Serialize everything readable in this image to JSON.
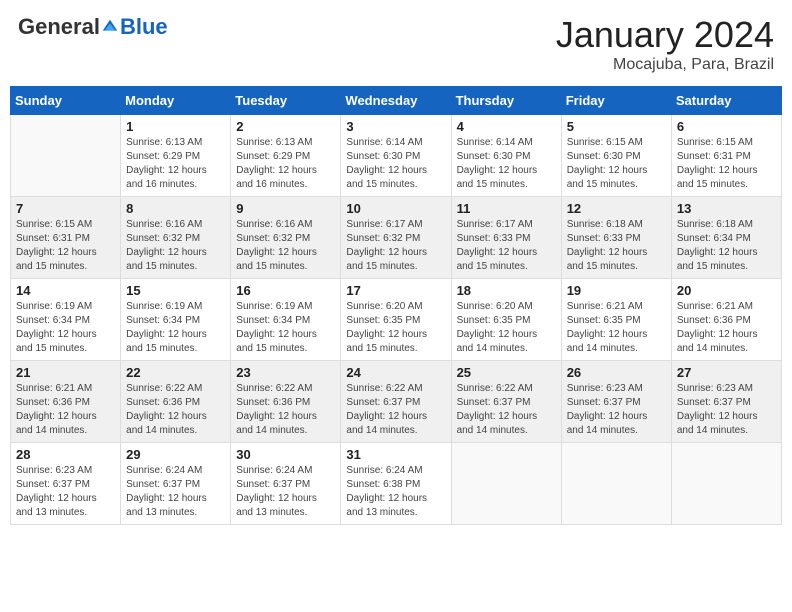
{
  "header": {
    "logo": {
      "general": "General",
      "blue": "Blue"
    },
    "title": "January 2024",
    "subtitle": "Mocajuba, Para, Brazil"
  },
  "weekdays": [
    "Sunday",
    "Monday",
    "Tuesday",
    "Wednesday",
    "Thursday",
    "Friday",
    "Saturday"
  ],
  "weeks": [
    [
      {
        "day": "",
        "sunrise": "",
        "sunset": "",
        "daylight": "",
        "empty": true
      },
      {
        "day": "1",
        "sunrise": "Sunrise: 6:13 AM",
        "sunset": "Sunset: 6:29 PM",
        "daylight": "Daylight: 12 hours and 16 minutes."
      },
      {
        "day": "2",
        "sunrise": "Sunrise: 6:13 AM",
        "sunset": "Sunset: 6:29 PM",
        "daylight": "Daylight: 12 hours and 16 minutes."
      },
      {
        "day": "3",
        "sunrise": "Sunrise: 6:14 AM",
        "sunset": "Sunset: 6:30 PM",
        "daylight": "Daylight: 12 hours and 15 minutes."
      },
      {
        "day": "4",
        "sunrise": "Sunrise: 6:14 AM",
        "sunset": "Sunset: 6:30 PM",
        "daylight": "Daylight: 12 hours and 15 minutes."
      },
      {
        "day": "5",
        "sunrise": "Sunrise: 6:15 AM",
        "sunset": "Sunset: 6:30 PM",
        "daylight": "Daylight: 12 hours and 15 minutes."
      },
      {
        "day": "6",
        "sunrise": "Sunrise: 6:15 AM",
        "sunset": "Sunset: 6:31 PM",
        "daylight": "Daylight: 12 hours and 15 minutes."
      }
    ],
    [
      {
        "day": "7",
        "sunrise": "Sunrise: 6:15 AM",
        "sunset": "Sunset: 6:31 PM",
        "daylight": "Daylight: 12 hours and 15 minutes."
      },
      {
        "day": "8",
        "sunrise": "Sunrise: 6:16 AM",
        "sunset": "Sunset: 6:32 PM",
        "daylight": "Daylight: 12 hours and 15 minutes."
      },
      {
        "day": "9",
        "sunrise": "Sunrise: 6:16 AM",
        "sunset": "Sunset: 6:32 PM",
        "daylight": "Daylight: 12 hours and 15 minutes."
      },
      {
        "day": "10",
        "sunrise": "Sunrise: 6:17 AM",
        "sunset": "Sunset: 6:32 PM",
        "daylight": "Daylight: 12 hours and 15 minutes."
      },
      {
        "day": "11",
        "sunrise": "Sunrise: 6:17 AM",
        "sunset": "Sunset: 6:33 PM",
        "daylight": "Daylight: 12 hours and 15 minutes."
      },
      {
        "day": "12",
        "sunrise": "Sunrise: 6:18 AM",
        "sunset": "Sunset: 6:33 PM",
        "daylight": "Daylight: 12 hours and 15 minutes."
      },
      {
        "day": "13",
        "sunrise": "Sunrise: 6:18 AM",
        "sunset": "Sunset: 6:34 PM",
        "daylight": "Daylight: 12 hours and 15 minutes."
      }
    ],
    [
      {
        "day": "14",
        "sunrise": "Sunrise: 6:19 AM",
        "sunset": "Sunset: 6:34 PM",
        "daylight": "Daylight: 12 hours and 15 minutes."
      },
      {
        "day": "15",
        "sunrise": "Sunrise: 6:19 AM",
        "sunset": "Sunset: 6:34 PM",
        "daylight": "Daylight: 12 hours and 15 minutes."
      },
      {
        "day": "16",
        "sunrise": "Sunrise: 6:19 AM",
        "sunset": "Sunset: 6:34 PM",
        "daylight": "Daylight: 12 hours and 15 minutes."
      },
      {
        "day": "17",
        "sunrise": "Sunrise: 6:20 AM",
        "sunset": "Sunset: 6:35 PM",
        "daylight": "Daylight: 12 hours and 15 minutes."
      },
      {
        "day": "18",
        "sunrise": "Sunrise: 6:20 AM",
        "sunset": "Sunset: 6:35 PM",
        "daylight": "Daylight: 12 hours and 14 minutes."
      },
      {
        "day": "19",
        "sunrise": "Sunrise: 6:21 AM",
        "sunset": "Sunset: 6:35 PM",
        "daylight": "Daylight: 12 hours and 14 minutes."
      },
      {
        "day": "20",
        "sunrise": "Sunrise: 6:21 AM",
        "sunset": "Sunset: 6:36 PM",
        "daylight": "Daylight: 12 hours and 14 minutes."
      }
    ],
    [
      {
        "day": "21",
        "sunrise": "Sunrise: 6:21 AM",
        "sunset": "Sunset: 6:36 PM",
        "daylight": "Daylight: 12 hours and 14 minutes."
      },
      {
        "day": "22",
        "sunrise": "Sunrise: 6:22 AM",
        "sunset": "Sunset: 6:36 PM",
        "daylight": "Daylight: 12 hours and 14 minutes."
      },
      {
        "day": "23",
        "sunrise": "Sunrise: 6:22 AM",
        "sunset": "Sunset: 6:36 PM",
        "daylight": "Daylight: 12 hours and 14 minutes."
      },
      {
        "day": "24",
        "sunrise": "Sunrise: 6:22 AM",
        "sunset": "Sunset: 6:37 PM",
        "daylight": "Daylight: 12 hours and 14 minutes."
      },
      {
        "day": "25",
        "sunrise": "Sunrise: 6:22 AM",
        "sunset": "Sunset: 6:37 PM",
        "daylight": "Daylight: 12 hours and 14 minutes."
      },
      {
        "day": "26",
        "sunrise": "Sunrise: 6:23 AM",
        "sunset": "Sunset: 6:37 PM",
        "daylight": "Daylight: 12 hours and 14 minutes."
      },
      {
        "day": "27",
        "sunrise": "Sunrise: 6:23 AM",
        "sunset": "Sunset: 6:37 PM",
        "daylight": "Daylight: 12 hours and 14 minutes."
      }
    ],
    [
      {
        "day": "28",
        "sunrise": "Sunrise: 6:23 AM",
        "sunset": "Sunset: 6:37 PM",
        "daylight": "Daylight: 12 hours and 13 minutes."
      },
      {
        "day": "29",
        "sunrise": "Sunrise: 6:24 AM",
        "sunset": "Sunset: 6:37 PM",
        "daylight": "Daylight: 12 hours and 13 minutes."
      },
      {
        "day": "30",
        "sunrise": "Sunrise: 6:24 AM",
        "sunset": "Sunset: 6:37 PM",
        "daylight": "Daylight: 12 hours and 13 minutes."
      },
      {
        "day": "31",
        "sunrise": "Sunrise: 6:24 AM",
        "sunset": "Sunset: 6:38 PM",
        "daylight": "Daylight: 12 hours and 13 minutes."
      },
      {
        "day": "",
        "sunrise": "",
        "sunset": "",
        "daylight": "",
        "empty": true
      },
      {
        "day": "",
        "sunrise": "",
        "sunset": "",
        "daylight": "",
        "empty": true
      },
      {
        "day": "",
        "sunrise": "",
        "sunset": "",
        "daylight": "",
        "empty": true
      }
    ]
  ]
}
